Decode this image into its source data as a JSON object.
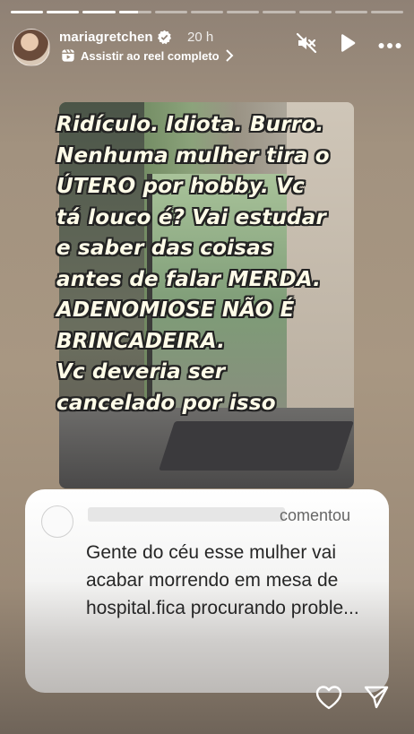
{
  "progress": {
    "total_segments": 11,
    "active_index": 3,
    "active_fill": 0.6
  },
  "header": {
    "username": "mariagretchen",
    "verified": true,
    "time": "20 h",
    "reel_link": "Assistir ao reel completo",
    "icons": [
      "mute-icon",
      "play-icon",
      "more-icon"
    ]
  },
  "story": {
    "text": "Ridículo. Idiota. Burro.\nNenhuma mulher tira o\nÚTERO por hobby. Vc\ntá louco é? Vai estudar\ne saber das coisas\nantes de falar MERDA.\nADENOMIOSE NÃO É\nBRINCADEIRA.\nVc deveria ser\ncancelado por isso"
  },
  "comment": {
    "action": "comentou",
    "body": "Gente do céu esse mulher vai acabar morrendo em mesa de hospital.fica procurando proble..."
  },
  "footer": {
    "icons": [
      "heart-icon",
      "send-icon"
    ]
  },
  "colors": {
    "text_outline": "#232323",
    "story_text": "#fffce8"
  }
}
